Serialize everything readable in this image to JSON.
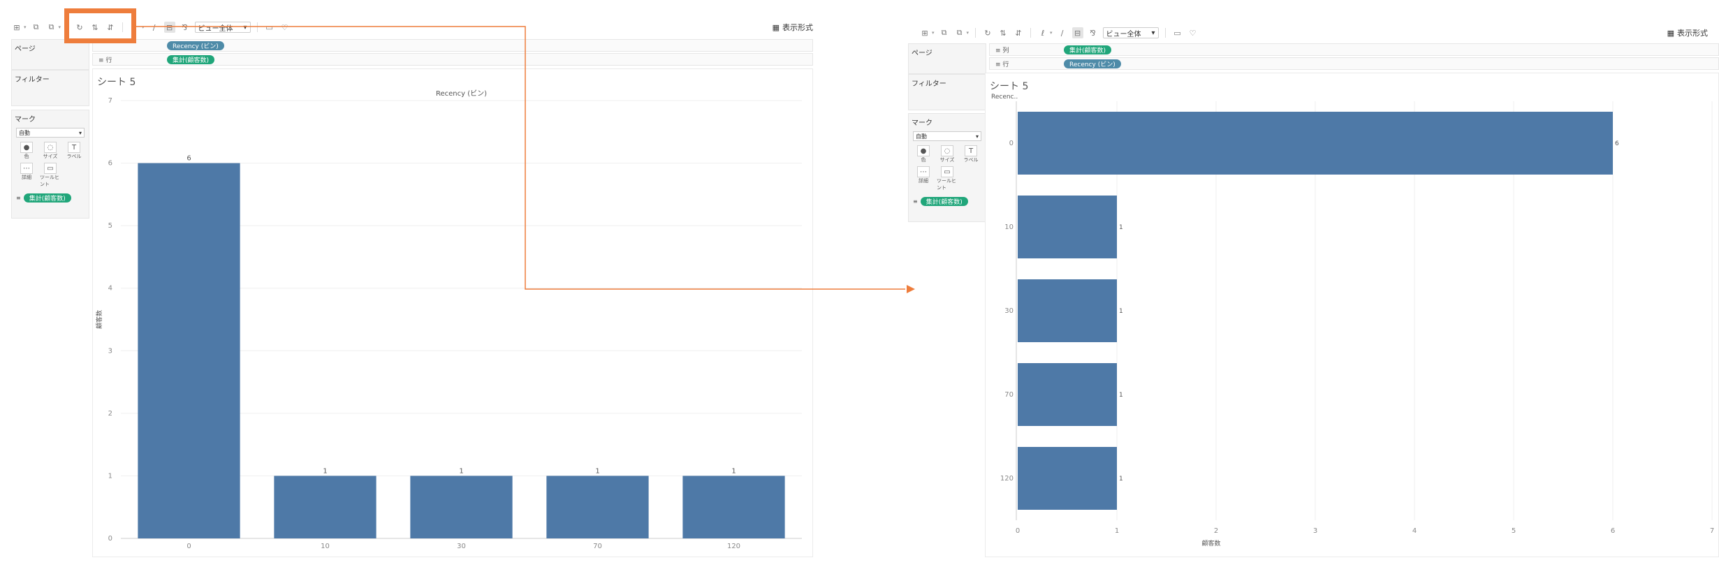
{
  "left": {
    "toolbar": {
      "view_select": "ビュー全体",
      "show_me": "表示形式"
    },
    "side": {
      "pages_label": "ページ",
      "filters_label": "フィルター",
      "marks_label": "マーク",
      "marks_type": "自動",
      "marks_cells": [
        {
          "icon": "color-icon",
          "glyph": "●",
          "label": "色"
        },
        {
          "icon": "size-icon",
          "glyph": "◌",
          "label": "サイズ"
        },
        {
          "icon": "label-icon",
          "glyph": "T",
          "label": "ラベル"
        },
        {
          "icon": "detail-icon",
          "glyph": "⋯",
          "label": "詳細"
        },
        {
          "icon": "tooltip-icon",
          "glyph": "▭",
          "label": "ツールヒント"
        }
      ],
      "marks_pill": "集計(顧客数)"
    },
    "shelves": {
      "columns_label": "",
      "columns_pill": "Recency (ビン)",
      "rows_label": "行",
      "rows_pill": "集計(顧客数)"
    },
    "sheet_title": "シート 5"
  },
  "right": {
    "toolbar": {
      "view_select": "ビュー全体",
      "show_me": "表示形式"
    },
    "side": {
      "pages_label": "ページ",
      "filters_label": "フィルター",
      "marks_label": "マーク",
      "marks_type": "自動",
      "marks_cells": [
        {
          "icon": "color-icon",
          "glyph": "●",
          "label": "色"
        },
        {
          "icon": "size-icon",
          "glyph": "◌",
          "label": "サイズ"
        },
        {
          "icon": "label-icon",
          "glyph": "T",
          "label": "ラベル"
        },
        {
          "icon": "detail-icon",
          "glyph": "⋯",
          "label": "詳細"
        },
        {
          "icon": "tooltip-icon",
          "glyph": "▭",
          "label": "ツールヒント"
        }
      ],
      "marks_pill": "集計(顧客数)"
    },
    "shelves": {
      "columns_label": "列",
      "columns_pill": "集計(顧客数)",
      "rows_label": "行",
      "rows_pill": "Recency (ビン)"
    },
    "sheet_title": "シート 5"
  },
  "colors": {
    "bar": "#4e79a7",
    "highlight": "#ee7d3c",
    "pill_green": "#20a67a",
    "pill_blue": "#4e8ba8"
  },
  "chart_data": [
    {
      "type": "bar",
      "orientation": "vertical",
      "title": "",
      "header": "Recency (ビン)",
      "categories": [
        "0",
        "10",
        "30",
        "70",
        "120"
      ],
      "values": [
        6,
        1,
        1,
        1,
        1
      ],
      "data_labels": [
        "6",
        "1",
        "1",
        "1",
        "1"
      ],
      "ylabel": "顧客数",
      "ylim": [
        0,
        7
      ],
      "yticks": [
        0,
        1,
        2,
        3,
        4,
        5,
        6,
        7
      ],
      "grid": true
    },
    {
      "type": "bar",
      "orientation": "horizontal",
      "title": "",
      "header": "Recenc..",
      "categories": [
        "0",
        "10",
        "30",
        "70",
        "120"
      ],
      "values": [
        6,
        1,
        1,
        1,
        1
      ],
      "data_labels": [
        "6",
        "1",
        "1",
        "1",
        "1"
      ],
      "xlabel": "顧客数",
      "xlim": [
        0,
        7
      ],
      "xticks": [
        0,
        1,
        2,
        3,
        4,
        5,
        6,
        7
      ],
      "grid": true
    }
  ]
}
